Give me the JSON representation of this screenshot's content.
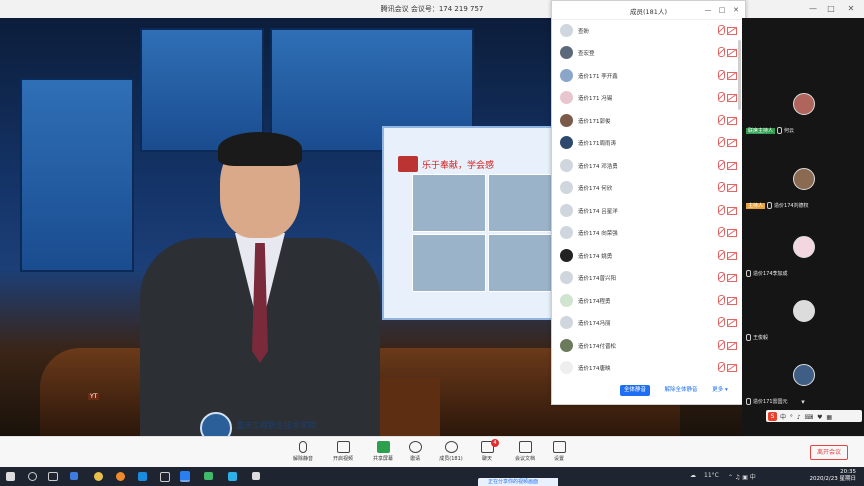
{
  "window": {
    "title": "腾讯会议 会议号：174 219 757",
    "controls": [
      "—",
      "□",
      "✕"
    ]
  },
  "stage": {
    "slide_heading": "乐于奉献，学会感",
    "school_name": "重庆工程职业技术学院",
    "watermark": "YT"
  },
  "members_panel": {
    "title": "成员(181人)",
    "controls": [
      "—",
      "□",
      "✕"
    ],
    "members": [
      {
        "name": "查盼"
      },
      {
        "name": "查宏登"
      },
      {
        "name": "造价171 李开鑫"
      },
      {
        "name": "造价171 冯锡"
      },
      {
        "name": "造价171郭俊"
      },
      {
        "name": "造价171周雨涛"
      },
      {
        "name": "造价174 邓浩勇"
      },
      {
        "name": "造价174 何欣"
      },
      {
        "name": "造价174 吕星洋"
      },
      {
        "name": "造价174 向荣强"
      },
      {
        "name": "造价174 姚勇"
      },
      {
        "name": "造价174曾兴阳"
      },
      {
        "name": "造价174程勇"
      },
      {
        "name": "造价174冯丽"
      },
      {
        "name": "造价174付晋松"
      },
      {
        "name": "造价174唐映"
      }
    ],
    "footer": {
      "mute_all": "全体静音",
      "unmute_all": "解除全体静音",
      "more": "更多 ▾"
    }
  },
  "gallery": {
    "tiles": [
      {
        "label": "联席主持人",
        "name": "何云",
        "badge_color": "#2e9e4f"
      },
      {
        "label": "主持人",
        "name": "造价174刘德权",
        "badge_color": "#e9a13a"
      },
      {
        "label": "",
        "name": "造价174李加成",
        "badge_color": ""
      },
      {
        "label": "",
        "name": "王俊毅",
        "badge_color": ""
      },
      {
        "label": "",
        "name": "造价171雷国元",
        "badge_color": ""
      }
    ],
    "ime_text": "中 ° ♪ ⌨ ♥ ▦"
  },
  "toolbar": {
    "buttons": [
      {
        "label": "解除静音"
      },
      {
        "label": "开启视频"
      },
      {
        "label": "共享屏幕"
      },
      {
        "label": "邀请"
      },
      {
        "label": "成员(181)"
      },
      {
        "label": "聊天"
      },
      {
        "label": "会议文档"
      },
      {
        "label": "设置"
      }
    ],
    "chat_badge": "4",
    "end_meeting": "离开会议"
  },
  "taskbar": {
    "temperature": "11°C",
    "time": "20:35",
    "date": "2020/2/23 星期日",
    "notification": "正在分享你的视频画面"
  },
  "colors": {
    "accent": "#1f6ff2",
    "danger": "#e54545"
  }
}
